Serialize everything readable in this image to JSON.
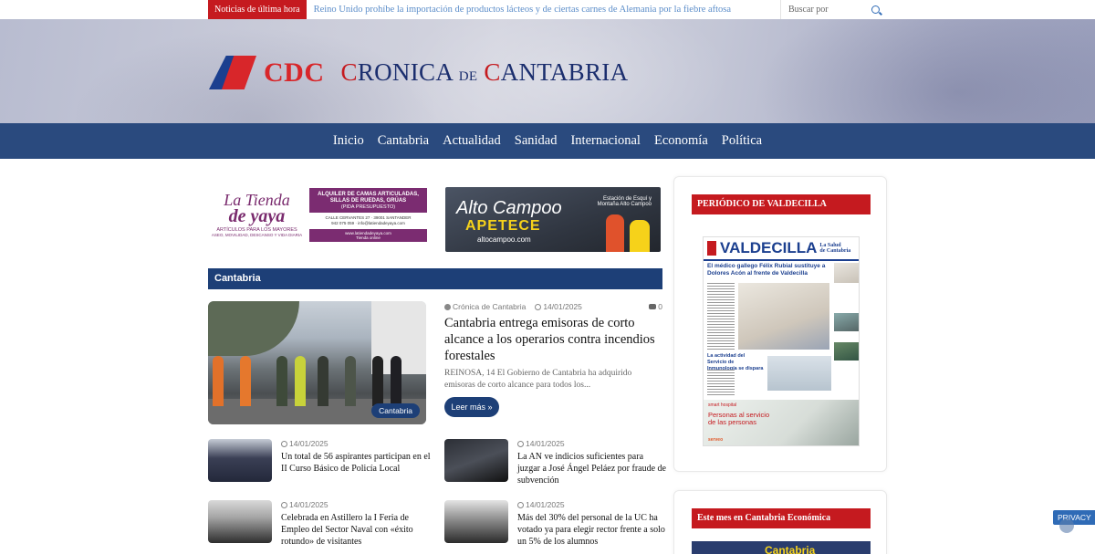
{
  "topbar": {
    "label": "Noticias de última hora",
    "ticker": "Reino Unido prohíbe la importación de productos lácteos y de ciertas carnes de Alemania por la fiebre aftosa",
    "search_placeholder": "Buscar por"
  },
  "logo": {
    "cdc": "CDC",
    "name_parts": [
      "C",
      "RONICA ",
      "DE",
      " C",
      "ANTABRIA"
    ]
  },
  "nav": [
    "Inicio",
    "Cantabria",
    "Actualidad",
    "Sanidad",
    "Internacional",
    "Economía",
    "Política"
  ],
  "ads": {
    "tienda": {
      "title_line1": "La Tienda",
      "title_line2": "de yaya",
      "sub": "ARTÍCULOS PARA LOS MAYORES",
      "sub2": "ASEO, MOVILIDAD, DESCANSO Y VIDA DIARIA",
      "right_heading": "ALQUILER DE CAMAS ARTICULADAS, SILLAS DE RUEDAS, GRÚAS",
      "right_note": "(PIDA PRESUPUESTO)",
      "right_address": "CALLE CERVANTES 27 · 39001 SANTANDER",
      "right_contact": "942 075 059 · info@latiendadeyaya.com",
      "right_web": "www.latiendadeyaya.com",
      "right_web_note": "Tienda online"
    },
    "altocampoo": {
      "title": "Alto Campoo",
      "slogan": "APETECE",
      "url": "altocampoo.com",
      "brand": "Estación de Esquí y Montaña Alto Campoo"
    }
  },
  "section": {
    "title": "Cantabria"
  },
  "featured": {
    "author": "Crónica de Cantabria",
    "date": "14/01/2025",
    "comments": "0",
    "title": "Cantabria entrega emisoras de corto alcance a los operarios contra incendios forestales",
    "excerpt": "REINOSA, 14 El Gobierno de Cantabria ha adquirido emisoras de corto alcance para todos los...",
    "badge": "Cantabria",
    "read_more": "Leer más »"
  },
  "articles": [
    {
      "date": "14/01/2025",
      "title": "Un total de 56 aspirantes participan en el II Curso Básico de Policía Local"
    },
    {
      "date": "14/01/2025",
      "title": "La AN ve indicios suficientes para juzgar a José Ángel Peláez por fraude de subvención"
    },
    {
      "date": "14/01/2025",
      "title": "Celebrada en Astillero la I Feria de Empleo del Sector Naval con «éxito rotundo» de visitantes"
    },
    {
      "date": "14/01/2025",
      "title": "Más del 30% del personal de la UC ha votado ya para elegir rector frente a solo un 5% de los alumnos"
    }
  ],
  "sidebar": {
    "valdecilla_tag": "PERIÓDICO DE VALDECILLA",
    "paper_name": "VALDECILLA",
    "paper_sub_line1": "La Salud",
    "paper_sub_line2": "de Cantabria",
    "paper_headline": "El médico gallego Félix Rubial sustituye a Dolores Acón al frente de Valdecilla",
    "paper_section": "La actividad del Servicio de Inmunología se dispara",
    "paper_ad_brand": "smart hospital",
    "paper_ad_slogan": "Personas al servicio de las personas",
    "paper_ad_company": "serveo",
    "economia_tag": "Este mes en Cantabria Económica",
    "economia_banner": "Cantabria"
  },
  "privacy": {
    "label": "PRIVACY"
  }
}
